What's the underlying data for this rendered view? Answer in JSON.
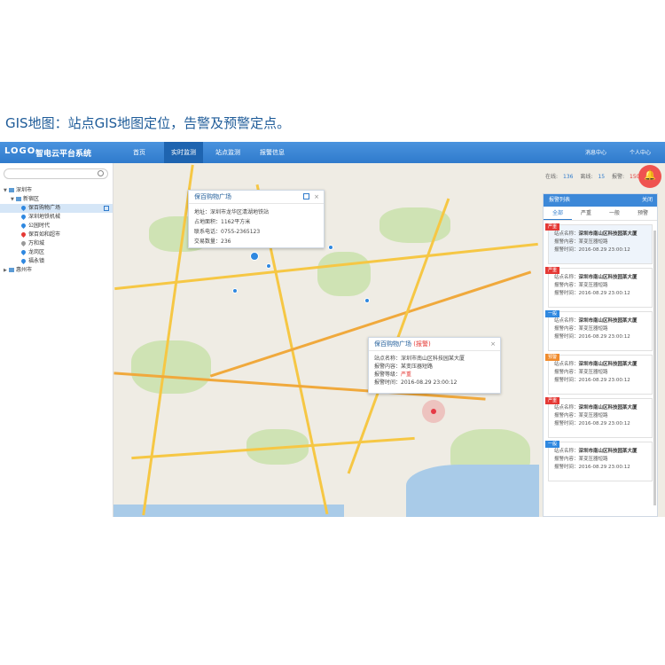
{
  "caption": "GIS地图：站点GIS地图定位，告警及预警定点。",
  "header": {
    "logo": "LOGO",
    "system_name": "智电云平台系统",
    "nav": [
      {
        "label": "首页"
      },
      {
        "label": "实时监测"
      },
      {
        "label": "站点监测"
      },
      {
        "label": "报警信息"
      }
    ],
    "alarm_center": "消息中心",
    "user_center": "个人中心"
  },
  "sidebar": {
    "search_placeholder": "",
    "tree": [
      {
        "label": "深圳市",
        "level": 0
      },
      {
        "label": "新宿区",
        "level": 1
      },
      {
        "label": "保百购物广场",
        "level": 2,
        "selected": true
      },
      {
        "label": "深圳地铁机械",
        "level": 2
      },
      {
        "label": "公园时代",
        "level": 2
      },
      {
        "label": "保百如和超市",
        "level": 2
      },
      {
        "label": "万和城",
        "level": 2
      },
      {
        "label": "龙岗区",
        "level": 2
      },
      {
        "label": "福永镇",
        "level": 2
      },
      {
        "label": "惠州市",
        "level": 0
      }
    ]
  },
  "stats": {
    "online_label": "在线:",
    "online": "136",
    "offline_label": "离线:",
    "offline": "15",
    "alarm_label": "报警:",
    "alarm": "150"
  },
  "popup_site": {
    "title": "保百购物广场",
    "address": "地址：深圳市龙华区清湖地铁站",
    "total_distance": "占地面积：1162平方米",
    "phone": "联系电话：0755-2365123",
    "count": "交易数量：236"
  },
  "popup_alarm": {
    "title": "保百购物广场",
    "title_tag": "(报警)",
    "station": "站点名称：深圳市南山区科技园某大厦",
    "content": "报警内容：某变压器短路",
    "level_label": "报警等级：",
    "level": "严重",
    "time": "报警时间：2016-08.29 23:00:12"
  },
  "alarm_panel": {
    "title": "报警列表",
    "close": "关闭",
    "tabs": [
      "全部",
      "严重",
      "一般",
      "预警"
    ],
    "items": [
      {
        "badge": "严重",
        "color": "red",
        "station": "深圳市南山区科技园某大厦",
        "content": "某变压器短路",
        "time": "2016-08.29 23:00:12"
      },
      {
        "badge": "严重",
        "color": "red",
        "station": "深圳市南山区科技园某大厦",
        "content": "某变压器短路",
        "time": "2016-08.29 23:00:12"
      },
      {
        "badge": "一般",
        "color": "blue",
        "station": "深圳市南山区科技园某大厦",
        "content": "某变压器短路",
        "time": "2016-08.29 23:00:12"
      },
      {
        "badge": "预警",
        "color": "orange",
        "station": "深圳市南山区科技园某大厦",
        "content": "某变压器短路",
        "time": "2016-08.29 23:00:12"
      },
      {
        "badge": "严重",
        "color": "red",
        "station": "深圳市南山区科技园某大厦",
        "content": "某变压器短路",
        "time": "2016-08.29 23:00:12"
      },
      {
        "badge": "一般",
        "color": "blue",
        "station": "深圳市南山区科技园某大厦",
        "content": "某变压器短路",
        "time": "2016-08.29 23:00:12"
      }
    ],
    "station_label": "站点名称：",
    "content_label": "报警内容：",
    "time_label": "报警时间："
  }
}
